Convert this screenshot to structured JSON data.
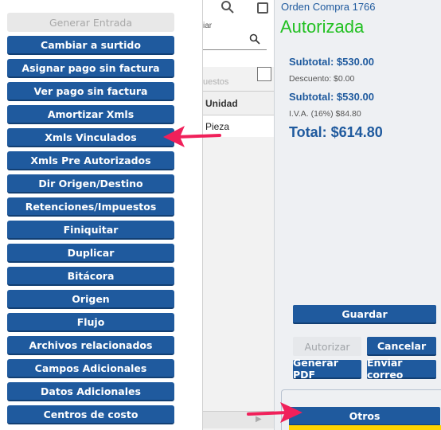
{
  "menu": {
    "items": [
      {
        "label": "Generar Entrada",
        "disabled": true
      },
      {
        "label": "Cambiar a surtido"
      },
      {
        "label": "Asignar pago sin factura"
      },
      {
        "label": "Ver pago sin factura"
      },
      {
        "label": "Amortizar Xmls"
      },
      {
        "label": "Xmls Vinculados"
      },
      {
        "label": "Xmls Pre Autorizados"
      },
      {
        "label": "Dir Origen/Destino"
      },
      {
        "label": "Retenciones/Impuestos"
      },
      {
        "label": "Finiquitar"
      },
      {
        "label": "Duplicar"
      },
      {
        "label": "Bitácora"
      },
      {
        "label": "Origen"
      },
      {
        "label": "Flujo"
      },
      {
        "label": "Archivos relacionados"
      },
      {
        "label": "Campos Adicionales"
      },
      {
        "label": "Datos Adicionales"
      },
      {
        "label": "Centros de costo"
      }
    ]
  },
  "middle": {
    "label_top": "iar",
    "label_taxes": "uestos",
    "column_header": "Unidad",
    "row_unit": "Pieza"
  },
  "order": {
    "title": "Orden Compra 1766",
    "status": "Autorizada",
    "subtotal1": "Subtotal: $530.00",
    "discount": "Descuento: $0.00",
    "subtotal2": "Subtotal: $530.00",
    "iva": "I.V.A. (16%) $84.80",
    "total": "Total: $614.80"
  },
  "actions": {
    "guardar": "Guardar",
    "autorizar": "Autorizar",
    "cancelar": "Cancelar",
    "generar_pdf": "Generar PDF",
    "enviar_correo": "Enviar correo",
    "otros": "Otros"
  },
  "colors": {
    "button_blue": "#1f5a9e",
    "status_green": "#22c022",
    "arrow_pink": "#f0205a",
    "accent_yellow": "#ffd400"
  },
  "icons": [
    "search-icon",
    "window-icon",
    "checkbox-icon",
    "arrow-pointer-icon"
  ]
}
